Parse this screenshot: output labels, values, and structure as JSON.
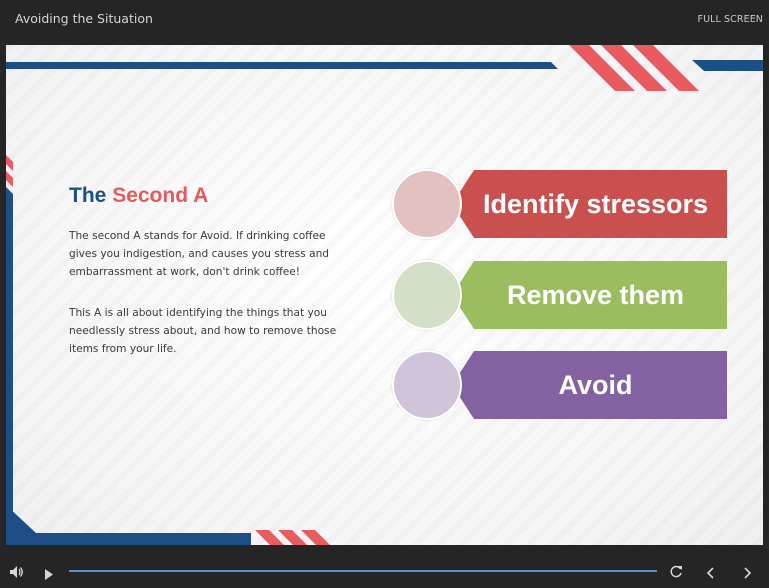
{
  "topbar": {
    "title": "Avoiding the Situation",
    "fullscreen_label": "FULL SCREEN"
  },
  "slide": {
    "heading_part1": "The",
    "heading_part2": "Second A",
    "paragraph1": "The second A stands for Avoid. If drinking coffee gives you indigestion, and causes you stress and embarrassment at work, don't drink coffee!",
    "paragraph2": "This A is all about identifying the things that you needlessly stress about, and how to remove those items from your life.",
    "steps": [
      {
        "label": "Identify stressors",
        "band_color": "#c9504f",
        "circle_color": "#e4c1c1"
      },
      {
        "label": "Remove them",
        "band_color": "#9bbd60",
        "circle_color": "#d3dfc7"
      },
      {
        "label": "Avoid",
        "band_color": "#8462a2",
        "circle_color": "#cfc4d9"
      }
    ],
    "colors": {
      "navy": "#1d4f86",
      "coral": "#e25c5f"
    }
  },
  "controls": {
    "volume_icon": "speaker-icon",
    "play_icon": "play-icon",
    "replay_icon": "replay-icon",
    "prev_icon": "chevron-left-icon",
    "next_icon": "chevron-right-icon"
  }
}
